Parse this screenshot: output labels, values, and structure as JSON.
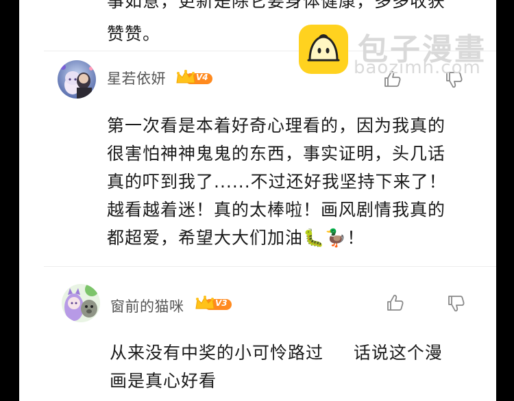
{
  "previous_comment": {
    "line1": "事如意，更新是除它要身体健康，多多收获",
    "line2": "赞赞。"
  },
  "watermark": {
    "brand": "包子漫畫",
    "url": "baozimh.com",
    "logo_color": "#ffd21f"
  },
  "comments": [
    {
      "username": "星若依妍",
      "vip_level": "V4",
      "like_icon": "thumbs-up-icon",
      "dislike_icon": "thumbs-down-icon",
      "text_lines": [
        "第一次看是本着好奇心理看的，因为我真的",
        "很害怕神神鬼鬼的东西，事实证明，头几话",
        "真的吓到我了......不过还好我坚持下来了！",
        "越看越着迷！真的太棒啦！画风剧情我真的",
        "都超爱，希望大大们加油🐛🦆！"
      ]
    },
    {
      "username": "窗前的猫咪",
      "vip_level": "V3",
      "like_icon": "thumbs-up-icon",
      "dislike_icon": "thumbs-down-icon",
      "text_lines": [
        "从来没有中奖的小可怜路过　  话说这个漫",
        "画是真心好看"
      ]
    }
  ],
  "colors": {
    "vip_badge": "#ff8a1f",
    "crown": "#ffc21a",
    "text": "#1a1a1a",
    "username": "#555555"
  }
}
